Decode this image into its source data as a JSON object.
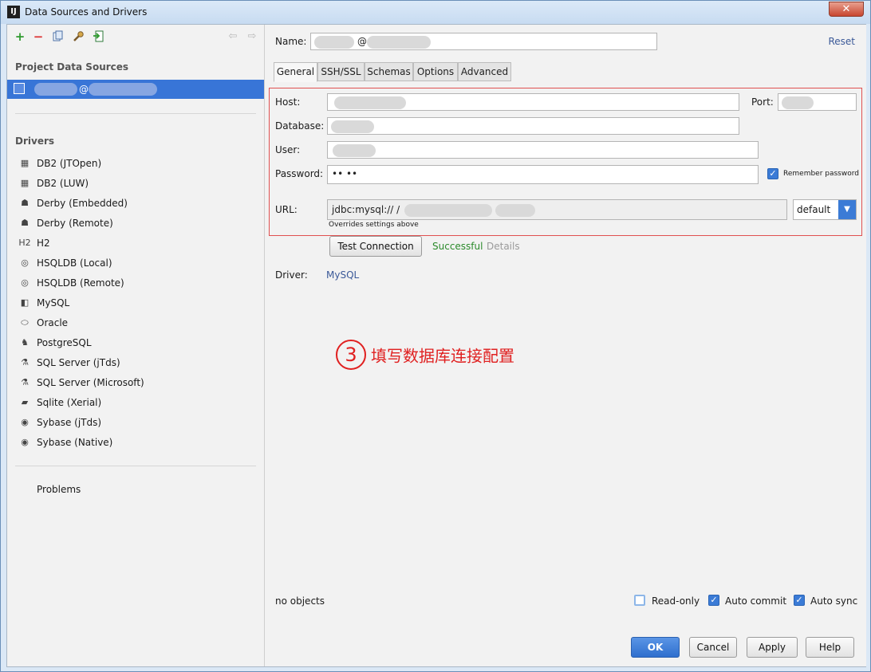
{
  "window": {
    "title": "Data Sources and Drivers",
    "close_label": "✕"
  },
  "left": {
    "project_section_title": "Project Data Sources",
    "selected_source_label": "@",
    "drivers_section_title": "Drivers",
    "drivers": [
      {
        "label": "DB2 (JTOpen)",
        "icon": "db2-icon"
      },
      {
        "label": "DB2 (LUW)",
        "icon": "db2-icon"
      },
      {
        "label": "Derby (Embedded)",
        "icon": "derby-icon"
      },
      {
        "label": "Derby (Remote)",
        "icon": "derby-icon"
      },
      {
        "label": "H2",
        "icon": "h2-icon"
      },
      {
        "label": "HSQLDB (Local)",
        "icon": "hsqldb-icon"
      },
      {
        "label": "HSQLDB (Remote)",
        "icon": "hsqldb-icon"
      },
      {
        "label": "MySQL",
        "icon": "mysql-icon"
      },
      {
        "label": "Oracle",
        "icon": "oracle-icon"
      },
      {
        "label": "PostgreSQL",
        "icon": "postgresql-icon"
      },
      {
        "label": "SQL Server (jTds)",
        "icon": "sqlserver-icon"
      },
      {
        "label": "SQL Server (Microsoft)",
        "icon": "sqlserver-icon"
      },
      {
        "label": "Sqlite (Xerial)",
        "icon": "sqlite-icon"
      },
      {
        "label": "Sybase (jTds)",
        "icon": "sybase-icon"
      },
      {
        "label": "Sybase (Native)",
        "icon": "sybase-icon"
      }
    ],
    "problems_label": "Problems"
  },
  "right": {
    "name_label": "Name:",
    "name_value": "@",
    "reset_label": "Reset",
    "tabs": [
      "General",
      "SSH/SSL",
      "Schemas",
      "Options",
      "Advanced"
    ],
    "host_label": "Host:",
    "port_label": "Port:",
    "database_label": "Database:",
    "user_label": "User:",
    "password_label": "Password:",
    "password_value": "••        ••",
    "remember_password_label": "Remember password",
    "url_label": "URL:",
    "url_value": "jdbc:mysql://                    /",
    "url_hint": "Overrides settings above",
    "url_mode": "default",
    "test_connection_label": "Test Connection",
    "test_status": "Successful",
    "details_label": "Details",
    "driver_label": "Driver:",
    "driver_value": "MySQL",
    "annotation_number": "3",
    "annotation_text": "填写数据库连接配置",
    "objects_status": "no objects",
    "read_only_label": "Read-only",
    "auto_commit_label": "Auto commit",
    "auto_sync_label": "Auto sync"
  },
  "footer": {
    "ok_label": "OK",
    "cancel_label": "Cancel",
    "apply_label": "Apply",
    "help_label": "Help"
  },
  "colors": {
    "selection": "#3875d7",
    "accent": "#3b7bd6",
    "success": "#2a8a2a",
    "annotation": "#e02020"
  }
}
